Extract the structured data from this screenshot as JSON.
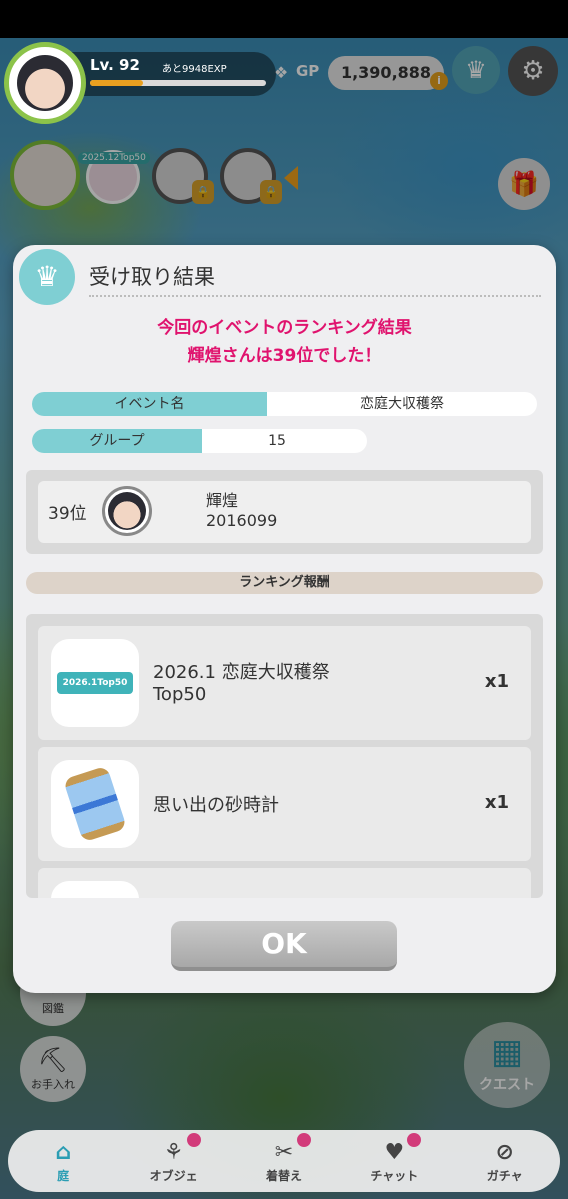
{
  "hud": {
    "level": "Lv. 92",
    "exp_remaining": "あと9948EXP",
    "exp_progress": 0.3,
    "gp_label": "GP",
    "gp_value": "1,390,888",
    "friend_badge": "2025.12Top50"
  },
  "modal": {
    "title": "受け取り結果",
    "result_line1": "今回のイベントのランキング結果",
    "result_line2": "輝煌さんは39位でした！",
    "event_name_label": "イベント名",
    "event_name_value": "恋庭大収穫祭",
    "group_label": "グループ",
    "group_value": "15",
    "player": {
      "rank": "39位",
      "name": "輝煌",
      "id": "2016099"
    },
    "reward_header": "ランキング報酬",
    "rewards": [
      {
        "name_line1": "2026.1 恋庭大収穫祭",
        "name_line2": "Top50",
        "qty": "x1",
        "thumb_text": "2026.1Top50",
        "icon": "trophy-ribbon-icon"
      },
      {
        "name_line1": "思い出の砂時計",
        "name_line2": "",
        "qty": "x1",
        "icon": "hourglass-icon"
      }
    ],
    "ok_label": "OK"
  },
  "side": {
    "zukan_label": "図鑑",
    "care_label": "お手入れ",
    "quest_label": "クエスト"
  },
  "nav": [
    {
      "label": "庭",
      "icon": "home-icon",
      "active": true
    },
    {
      "label": "オブジェ",
      "icon": "object-icon",
      "badge": true
    },
    {
      "label": "着替え",
      "icon": "wardrobe-icon",
      "badge": true
    },
    {
      "label": "チャット",
      "icon": "chat-icon",
      "badge": true
    },
    {
      "label": "ガチャ",
      "icon": "gacha-icon"
    }
  ],
  "colors": {
    "accent": "#7fcfd3",
    "result_text": "#e0136e",
    "nav_active": "#2a9db3",
    "badge": "#d23b7a"
  }
}
